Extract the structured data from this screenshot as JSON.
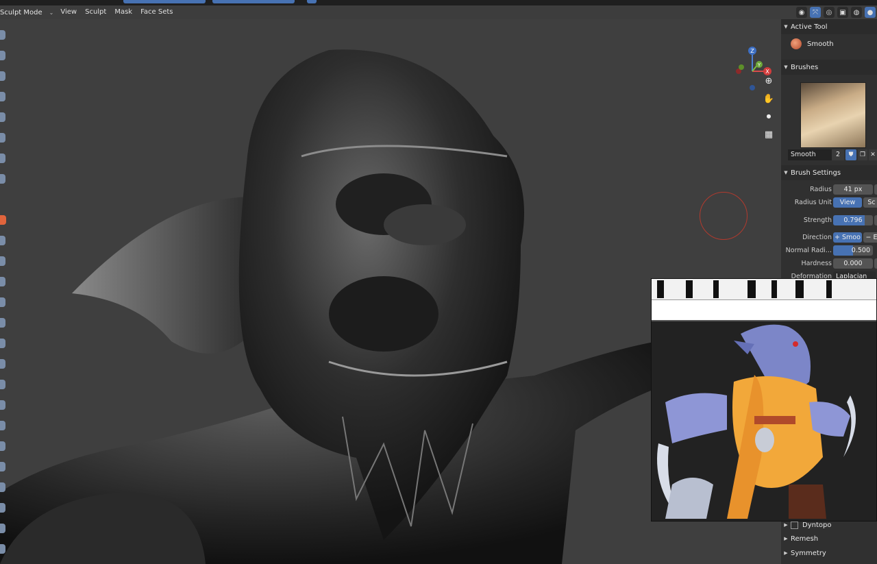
{
  "header": {
    "mode": "Sculpt Mode",
    "menus": [
      "View",
      "Sculpt",
      "Mask",
      "Face Sets"
    ]
  },
  "icons": {
    "mode_dropdown": "chevron-down-icon",
    "visibility": "eye-icon",
    "gizmo": "gizmo-toggle-icon",
    "overlays": "overlays-icon",
    "xray": "xray-icon",
    "shading": [
      "wireframe-shading-icon",
      "solid-shading-icon"
    ],
    "nav": [
      "zoom-icon",
      "hand-pan-icon",
      "camera-icon",
      "grid-perspective-icon"
    ]
  },
  "gizmo": {
    "z_label": "Z",
    "y_label": "Y",
    "x_label": "X"
  },
  "panel": {
    "active_tool": {
      "title": "Active Tool",
      "tool_name": "Smooth"
    },
    "brushes": {
      "title": "Brushes",
      "brush_name": "Smooth",
      "users": "2"
    },
    "brush_settings": {
      "title": "Brush Settings",
      "radius_label": "Radius",
      "radius_value": "41 px",
      "radius_unit_label": "Radius Unit",
      "radius_unit_options": [
        "View",
        "Sc"
      ],
      "strength_label": "Strength",
      "strength_value": "0.796",
      "strength_fraction": 0.796,
      "direction_label": "Direction",
      "direction_options": [
        "+ Smoo",
        "− E"
      ],
      "normal_radius_label": "Normal Radi...",
      "normal_radius_value": "0.500",
      "normal_radius_fraction": 0.5,
      "hardness_label": "Hardness",
      "hardness_value": "0.000",
      "deformation_label": "Deformation",
      "deformation_value": "Laplacian"
    },
    "subpanels": [
      {
        "label": "Dyntopo",
        "has_checkbox": true
      },
      {
        "label": "Remesh",
        "has_checkbox": false
      },
      {
        "label": "Symmetry",
        "has_checkbox": false
      }
    ]
  },
  "colors": {
    "accent_blue": "#4772b3",
    "panel_bg": "#303030",
    "viewport_bg": "#3f3f3f",
    "brush_cursor": "#b23a2e"
  }
}
